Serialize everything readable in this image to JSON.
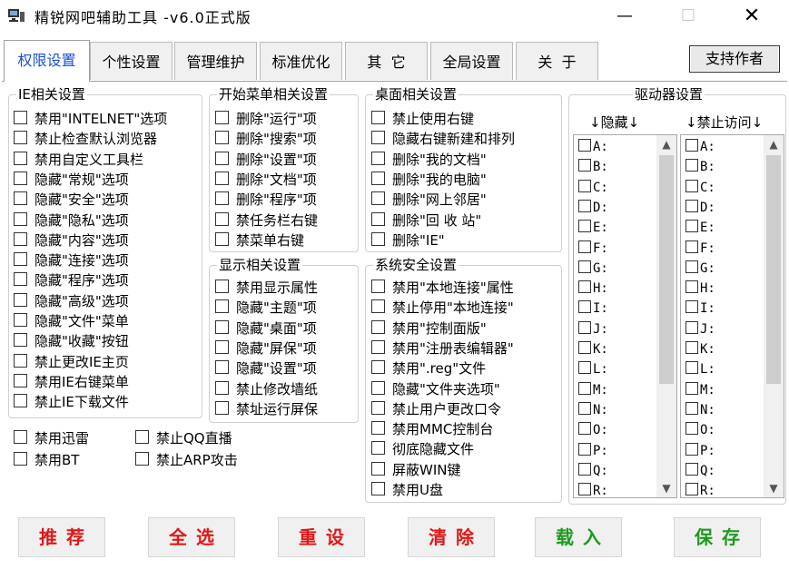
{
  "window": {
    "title": "精锐网吧辅助工具    -v6.0正式版",
    "min_glyph": "—",
    "max_glyph": "☐",
    "close_glyph": "✕"
  },
  "tabs": [
    {
      "label": "权限设置",
      "active": true
    },
    {
      "label": "个性设置"
    },
    {
      "label": "管理维护"
    },
    {
      "label": "标准优化"
    },
    {
      "label": "其  它"
    },
    {
      "label": "全局设置"
    },
    {
      "label": "关  于"
    }
  ],
  "support_button": "支持作者",
  "groups": {
    "ie": {
      "title": "IE相关设置",
      "items": [
        "禁用\"INTELNET\"选项",
        "禁止检查默认浏览器",
        "禁用自定义工具栏",
        "隐藏\"常规\"选项",
        "隐藏\"安全\"选项",
        "隐藏\"隐私\"选项",
        "隐藏\"内容\"选项",
        "隐藏\"连接\"选项",
        "隐藏\"程序\"选项",
        "隐藏\"高级\"选项",
        "隐藏\"文件\"菜单",
        "隐藏\"收藏\"按钮",
        "禁止更改IE主页",
        "禁用IE右键菜单",
        "禁止IE下载文件"
      ]
    },
    "start_menu": {
      "title": "开始菜单相关设置",
      "items": [
        "删除\"运行\"项",
        "删除\"搜索\"项",
        "删除\"设置\"项",
        "删除\"文档\"项",
        "删除\"程序\"项",
        "禁任务栏右键",
        "禁菜单右键"
      ]
    },
    "display": {
      "title": "显示相关设置",
      "items": [
        "禁用显示属性",
        "隐藏\"主题\"项",
        "隐藏\"桌面\"项",
        "隐藏\"屏保\"项",
        "隐藏\"设置\"项",
        "禁止修改墙纸",
        "禁址运行屏保"
      ]
    },
    "desktop": {
      "title": "桌面相关设置",
      "items": [
        "禁止使用右键",
        "隐藏右键新建和排列",
        "删除\"我的文档\"",
        "删除\"我的电脑\"",
        "删除\"网上邻居\"",
        "删除\"回 收 站\"",
        "删除\"IE\""
      ]
    },
    "security": {
      "title": "系统安全设置",
      "items": [
        "禁用\"本地连接\"属性",
        "禁止停用\"本地连接\"",
        "禁用\"控制面版\"",
        "禁用\"注册表编辑器\"",
        "禁用\".reg\"文件",
        "隐藏\"文件夹选项\"",
        "禁止用户更改口令",
        "禁用MMC控制台",
        "彻底隐藏文件",
        "屏蔽WIN键",
        "禁用U盘"
      ]
    },
    "loose": {
      "left": [
        "禁用迅雷",
        "禁用BT"
      ],
      "right": [
        "禁止QQ直播",
        "禁止ARP攻击"
      ]
    },
    "drives": {
      "title": "驱动器设置",
      "hide_header": "↓隐藏↓",
      "deny_header": "↓禁止访问↓",
      "letters": [
        "A:",
        "B:",
        "C:",
        "D:",
        "E:",
        "F:",
        "G:",
        "H:",
        "I:",
        "J:",
        "K:",
        "L:",
        "M:",
        "N:",
        "O:",
        "P:",
        "Q:",
        "R:"
      ],
      "arrow_up": "▲",
      "arrow_down": "▼"
    }
  },
  "actions": [
    {
      "label": "推荐",
      "color": "#e01818"
    },
    {
      "label": "全选",
      "color": "#e01818"
    },
    {
      "label": "重设",
      "color": "#e01818"
    },
    {
      "label": "清除",
      "color": "#e01818"
    },
    {
      "label": "载入",
      "color": "#1f9a1f"
    },
    {
      "label": "保存",
      "color": "#1f9a1f"
    }
  ],
  "colors": {
    "active_tab": "#1a4fd6"
  }
}
